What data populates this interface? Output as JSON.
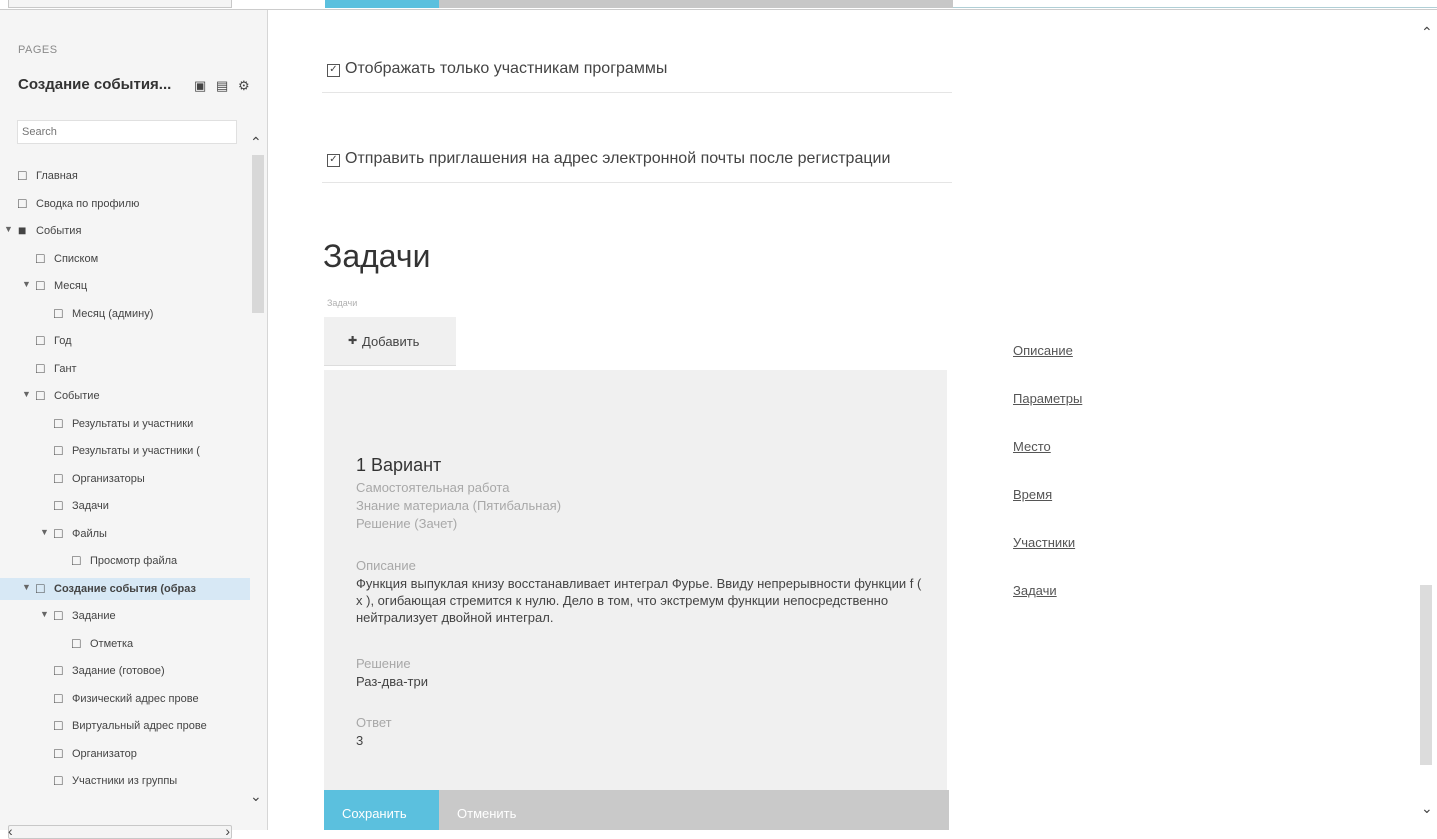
{
  "sidebar": {
    "pages_label": "PAGES",
    "title": "Создание события...",
    "search_placeholder": "Search",
    "tree": [
      {
        "label": "Главная",
        "depth": 0,
        "type": "page",
        "caret": false
      },
      {
        "label": "Сводка по профилю",
        "depth": 0,
        "type": "page",
        "caret": false
      },
      {
        "label": "События",
        "depth": 0,
        "type": "folder",
        "caret": true
      },
      {
        "label": "Списком",
        "depth": 1,
        "type": "page",
        "caret": false
      },
      {
        "label": "Месяц",
        "depth": 1,
        "type": "page",
        "caret": true
      },
      {
        "label": "Месяц (админу)",
        "depth": 2,
        "type": "page",
        "caret": false
      },
      {
        "label": "Год",
        "depth": 1,
        "type": "page",
        "caret": false
      },
      {
        "label": "Гант",
        "depth": 1,
        "type": "page",
        "caret": false
      },
      {
        "label": "Событие",
        "depth": 1,
        "type": "page",
        "caret": true
      },
      {
        "label": "Результаты и участники",
        "depth": 2,
        "type": "page",
        "caret": false
      },
      {
        "label": "Результаты и участники (",
        "depth": 2,
        "type": "page",
        "caret": false
      },
      {
        "label": "Организаторы",
        "depth": 2,
        "type": "page",
        "caret": false
      },
      {
        "label": "Задачи",
        "depth": 2,
        "type": "page",
        "caret": false
      },
      {
        "label": "Файлы",
        "depth": 2,
        "type": "page",
        "caret": true
      },
      {
        "label": "Просмотр файла",
        "depth": 3,
        "type": "page",
        "caret": false
      },
      {
        "label": "Создание события (образ",
        "depth": 1,
        "type": "page",
        "caret": true,
        "selected": true
      },
      {
        "label": "Задание",
        "depth": 2,
        "type": "page",
        "caret": true
      },
      {
        "label": "Отметка",
        "depth": 3,
        "type": "page",
        "caret": false
      },
      {
        "label": "Задание (готовое)",
        "depth": 2,
        "type": "page",
        "caret": false
      },
      {
        "label": "Физический адрес прове",
        "depth": 2,
        "type": "page",
        "caret": false
      },
      {
        "label": "Виртуальный адрес прове",
        "depth": 2,
        "type": "page",
        "caret": false
      },
      {
        "label": "Организатор",
        "depth": 2,
        "type": "page",
        "caret": false
      },
      {
        "label": "Участники из группы",
        "depth": 2,
        "type": "page",
        "caret": false
      }
    ]
  },
  "main": {
    "checkbox_1": "Отображать только участникам программы",
    "checkbox_2": "Отправить приглашения на адрес электронной почты после регистрации",
    "tasks_heading": "Задачи",
    "tasks_sub": "Задачи",
    "add_button": "Добавить",
    "variant": {
      "title": "1 Вариант",
      "type": "Самостоятельная работа",
      "grading": "Знание материала (Пятибальная)",
      "solution_kind": "Решение (Зачет)",
      "description_label": "Описание",
      "description": "Функция выпуклая книзу восстанавливает интеграл Фурье. Ввиду непрерывности функции f ( x ), огибающая стремится к нулю. Дело в том, что экстремум функции непосредственно нейтрализует двойной интеграл.",
      "solution_label": "Решение",
      "solution": "Раз-два-три",
      "answer_label": "Ответ",
      "answer": "3"
    },
    "save_button": "Сохранить",
    "cancel_button": "Отменить"
  },
  "right_nav": [
    "Описание",
    "Параметры",
    "Место",
    "Время",
    "Участники",
    "Задачи"
  ],
  "colors": {
    "accent": "#5bc0de",
    "selected": "#d7e8f5",
    "card": "#f0f0f0"
  }
}
